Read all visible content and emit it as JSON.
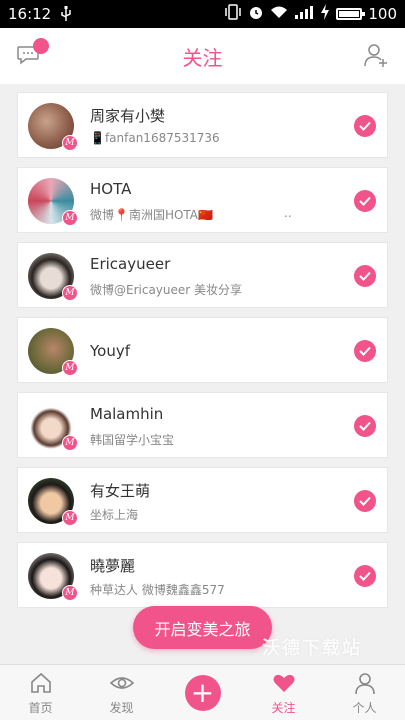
{
  "status_bar": {
    "time": "16:12",
    "battery": "100"
  },
  "header": {
    "title": "关注"
  },
  "users": [
    {
      "name": "周家有小樊",
      "sub": "📱fanfan1687531736"
    },
    {
      "name": "HOTA",
      "sub": "微博📍南洲国HOTA🇨🇳",
      "sub_extra": ".."
    },
    {
      "name": "Ericayueer",
      "sub": "微博@Ericayueer 美妆分享"
    },
    {
      "name": "Youyf",
      "sub": ""
    },
    {
      "name": "Malamhin",
      "sub": "韩国留学小宝宝"
    },
    {
      "name": "有女王萌",
      "sub": "坐标上海"
    },
    {
      "name": "曉夢麗",
      "sub": "种草达人 微博魏鑫鑫577"
    }
  ],
  "fab": {
    "label": "开启变美之旅"
  },
  "watermark": "沃德下载站",
  "nav": {
    "home": "首页",
    "discover": "发现",
    "follow": "关注",
    "profile": "个人"
  },
  "colors": {
    "accent": "#f0548a"
  }
}
